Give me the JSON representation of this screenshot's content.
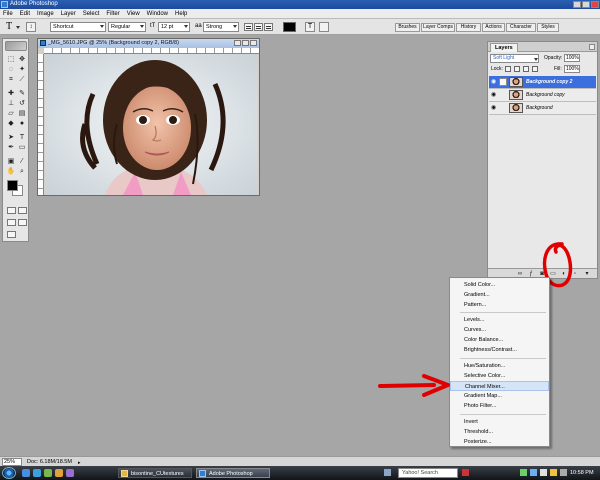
{
  "app": {
    "title": "Adobe Photoshop",
    "menu": [
      "File",
      "Edit",
      "Image",
      "Layer",
      "Select",
      "Filter",
      "View",
      "Window",
      "Help"
    ]
  },
  "options_bar": {
    "tool_icon": "type-tool-icon",
    "font_family": "Shortcut",
    "font_style": "Regular",
    "font_size": "12 pt",
    "antialias": "Strong",
    "color": "#000000"
  },
  "panel_tabs": [
    "Brushes",
    "Layer Comps",
    "History",
    "Actions",
    "Character",
    "Styles"
  ],
  "document": {
    "title": "_MG_5610.JPG @ 25% (Background copy 2, RGB/8)"
  },
  "layers_panel": {
    "tab": "Layers",
    "blend_mode": "Soft Light",
    "opacity_label": "Opacity:",
    "opacity_value": "100%",
    "lock_label": "Lock:",
    "fill_label": "Fill:",
    "fill_value": "100%",
    "layers": [
      {
        "name": "Background copy 2",
        "selected": true
      },
      {
        "name": "Background copy",
        "selected": false
      },
      {
        "name": "Background",
        "selected": false
      }
    ]
  },
  "adjustment_menu": {
    "groups": [
      [
        "Solid Color...",
        "Gradient...",
        "Pattern..."
      ],
      [
        "Levels...",
        "Curves...",
        "Color Balance...",
        "Brightness/Contrast..."
      ],
      [
        "Hue/Saturation...",
        "Selective Color...",
        "Channel Mixer...",
        "Gradient Map...",
        "Photo Filter..."
      ],
      [
        "Invert",
        "Threshold...",
        "Posterize..."
      ]
    ],
    "highlighted": "Channel Mixer..."
  },
  "annotations": {
    "color": "#e00000"
  },
  "status_bar": {
    "zoom": "25%",
    "doc_size": "Doc: 6.18M/18.5M"
  },
  "taskbar": {
    "tasks": [
      {
        "label": "bisontine_CUtextures",
        "active": false
      },
      {
        "label": "Adobe Photoshop",
        "active": true
      }
    ],
    "search_placeholder": "Yahoo! Search",
    "clock": "10:58 PM"
  }
}
